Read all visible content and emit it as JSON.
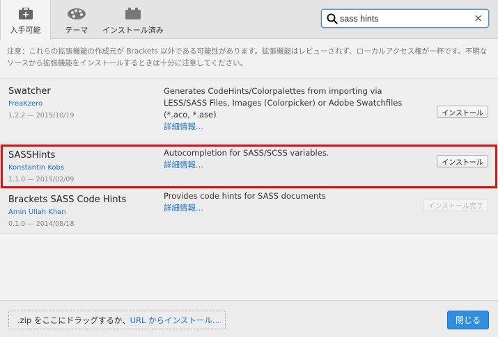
{
  "tabs": [
    {
      "label": "入手可能",
      "icon": "briefcase-icon",
      "active": true
    },
    {
      "label": "テーマ",
      "icon": "palette-icon",
      "active": false
    },
    {
      "label": "インストール済み",
      "icon": "installed-briefcase-icon",
      "active": false
    }
  ],
  "search": {
    "value": "sass hints",
    "placeholder": ""
  },
  "warning": "注意：これらの拡張機能の作成元が Brackets 以外である可能性があります。拡張機能はレビューされず、ローカルアクセス権が一杯です。不明なソースから拡張機能をインストールするときは十分に注意してください。",
  "extensions": [
    {
      "name": "Swatcher",
      "author": "FreaKzero",
      "version": "1.2.2 — 2015/10/19",
      "description": "Generates CodeHints/Colorpalettes from importing via LESS/SASS Files, Images (Colorpicker) or Adobe Swatchfiles (*.aco, *.ase)",
      "more": "詳細情報...",
      "button": "インストール",
      "button_disabled": false
    },
    {
      "name": "SASSHints",
      "author": "Konstantin Kobs",
      "version": "1.1.0 — 2015/02/09",
      "description": "Autocompletion for SASS/SCSS variables.",
      "more": "詳細情報...",
      "button": "インストール",
      "button_disabled": false
    },
    {
      "name": "Brackets SASS Code Hints",
      "author": "Amin Ullah Khan",
      "version": "0.1.0 — 2014/08/18",
      "description": "Provides code hints for SASS documents",
      "more": "詳細情報...",
      "button": "インストール完了",
      "button_disabled": true
    }
  ],
  "footer": {
    "drop_text": ".zip をここにドラッグするか、",
    "url_link": "URL からインストール...",
    "close_label": "閉じる"
  },
  "colors": {
    "accent": "#2f8ee0",
    "link": "#1a73c9",
    "highlight": "#e01010"
  }
}
